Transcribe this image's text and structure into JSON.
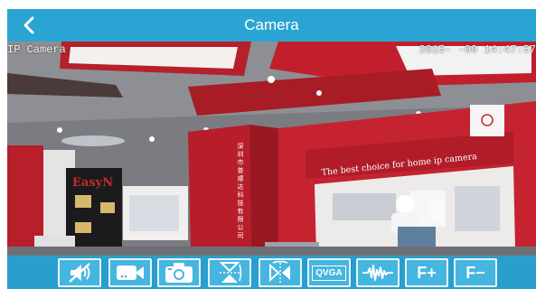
{
  "header": {
    "title": "Camera",
    "back_icon": "back-chevron-icon"
  },
  "feed": {
    "camera_label": "IP Camera",
    "timestamp": "2015-  -09 14:47:57",
    "scene": {
      "sign_brand": "EasyN",
      "slogan": "The best choice for home ip camera",
      "vertical_text": "深圳市普顺达科技有限公司"
    }
  },
  "toolbar": {
    "buttons": [
      {
        "name": "audio-mute-button",
        "icon": "speaker-muted-icon"
      },
      {
        "name": "record-video-button",
        "icon": "video-camera-icon"
      },
      {
        "name": "snapshot-button",
        "icon": "camera-icon"
      },
      {
        "name": "flip-vertical-button",
        "icon": "flip-vertical-icon"
      },
      {
        "name": "mirror-horizontal-button",
        "icon": "mirror-horizontal-icon"
      },
      {
        "name": "resolution-button",
        "label": "QVGA"
      },
      {
        "name": "waveform-button",
        "icon": "waveform-icon"
      },
      {
        "name": "focus-plus-button",
        "label": "F+"
      },
      {
        "name": "focus-minus-button",
        "label": "F−"
      }
    ]
  },
  "colors": {
    "header": "#2aa5d3",
    "toolbar": "#2a9ecc",
    "button_fill": "#45b6e0",
    "accent_red": "#b5202a"
  }
}
